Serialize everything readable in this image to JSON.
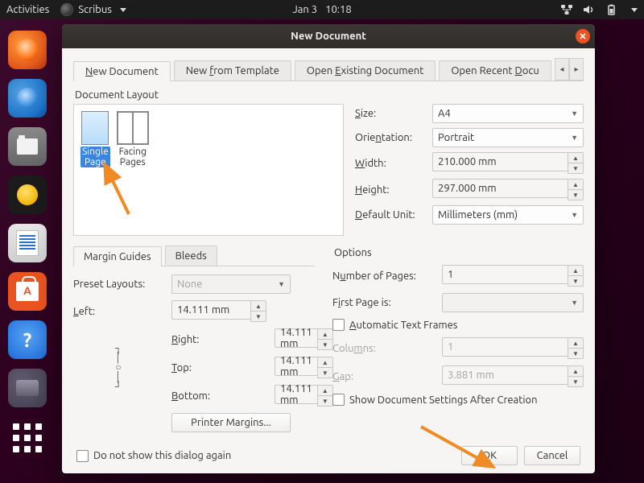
{
  "menubar": {
    "activities": "Activities",
    "app_name": "Scribus",
    "date": "Jan 3",
    "time": "10:18"
  },
  "dialog": {
    "title": "New Document",
    "tabs": {
      "new_document": "New Document",
      "new_from_template": "New from Template",
      "open_existing": "Open Existing Document",
      "open_recent": "Open Recent Docu"
    },
    "doc_layout_label": "Document Layout",
    "layout_items": {
      "single_page": "Single Page",
      "facing_pages": "Facing Pages"
    },
    "spec": {
      "size_label": "Size:",
      "size_value": "A4",
      "orientation_label": "Orientation:",
      "orientation_value": "Portrait",
      "width_label": "Width:",
      "width_value": "210.000 mm",
      "height_label": "Height:",
      "height_value": "297.000 mm",
      "default_unit_label": "Default Unit:",
      "default_unit_value": "Millimeters (mm)"
    },
    "margins": {
      "tab_margin_guides": "Margin Guides",
      "tab_bleeds": "Bleeds",
      "preset_label": "Preset Layouts:",
      "preset_value": "None",
      "left_label": "Left:",
      "left_value": "14.111 mm",
      "right_label": "Right:",
      "right_value": "14.111 mm",
      "top_label": "Top:",
      "top_value": "14.111 mm",
      "bottom_label": "Bottom:",
      "bottom_value": "14.111 mm",
      "printer_margins": "Printer Margins..."
    },
    "options": {
      "label": "Options",
      "num_pages_label": "Number of Pages:",
      "num_pages_value": "1",
      "first_page_label": "First Page is:",
      "first_page_value": "",
      "auto_text_frames": "Automatic Text Frames",
      "columns_label": "Columns:",
      "columns_value": "1",
      "gap_label": "Gap:",
      "gap_value": "3.881 mm",
      "show_settings": "Show Document Settings After Creation"
    },
    "footer": {
      "dont_show": "Do not show this dialog again",
      "ok": "OK",
      "cancel": "Cancel"
    }
  }
}
